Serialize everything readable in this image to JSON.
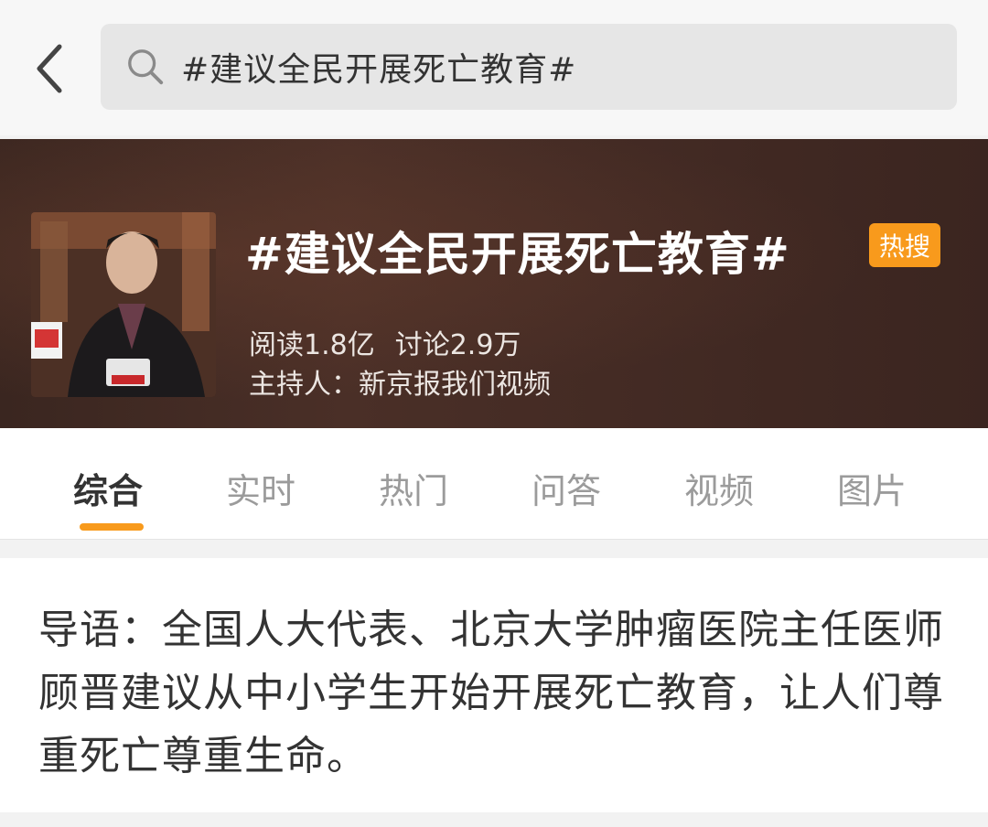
{
  "search": {
    "query": "#建议全民开展死亡教育#"
  },
  "banner": {
    "title": "#建议全民开展死亡教育#",
    "badge": "热搜",
    "reads": "阅读1.8亿",
    "discussions": "讨论2.9万",
    "host": "主持人：新京报我们视频"
  },
  "tabs": [
    {
      "label": "综合",
      "active": true
    },
    {
      "label": "实时",
      "active": false
    },
    {
      "label": "热门",
      "active": false
    },
    {
      "label": "问答",
      "active": false
    },
    {
      "label": "视频",
      "active": false
    },
    {
      "label": "图片",
      "active": false
    }
  ],
  "intro": {
    "text": "导语：全国人大代表、北京大学肿瘤医院主任医师顾晋建议从中小学生开始开展死亡教育，让人们尊重死亡尊重生命。"
  },
  "colors": {
    "accent": "#f89a1c",
    "banner_bg": "#3a2620"
  },
  "icons": {
    "back": "chevron-left-icon",
    "search": "search-icon"
  }
}
